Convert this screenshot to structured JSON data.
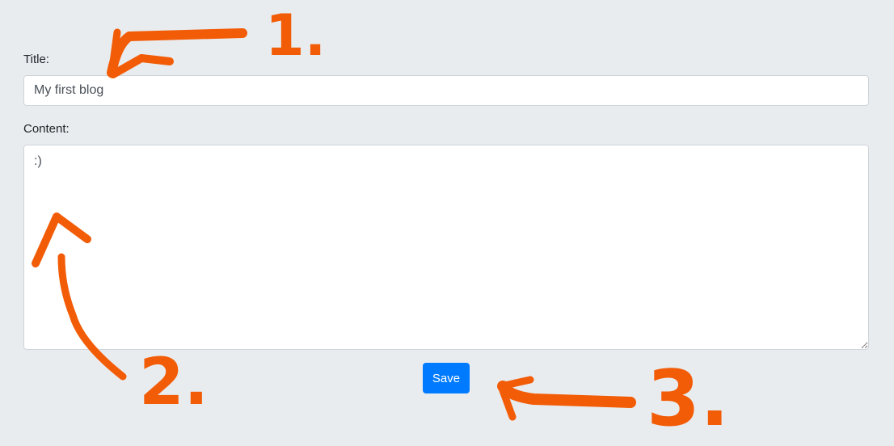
{
  "form": {
    "title_label": "Title:",
    "title_value": "My first blog",
    "content_label": "Content:",
    "content_value": ":)",
    "save_label": "Save"
  },
  "annotations": {
    "color": "#f25c07",
    "markers": [
      "1.",
      "2.",
      "3."
    ]
  },
  "colors": {
    "background": "#e9ecef",
    "primary_button": "#007bff"
  }
}
